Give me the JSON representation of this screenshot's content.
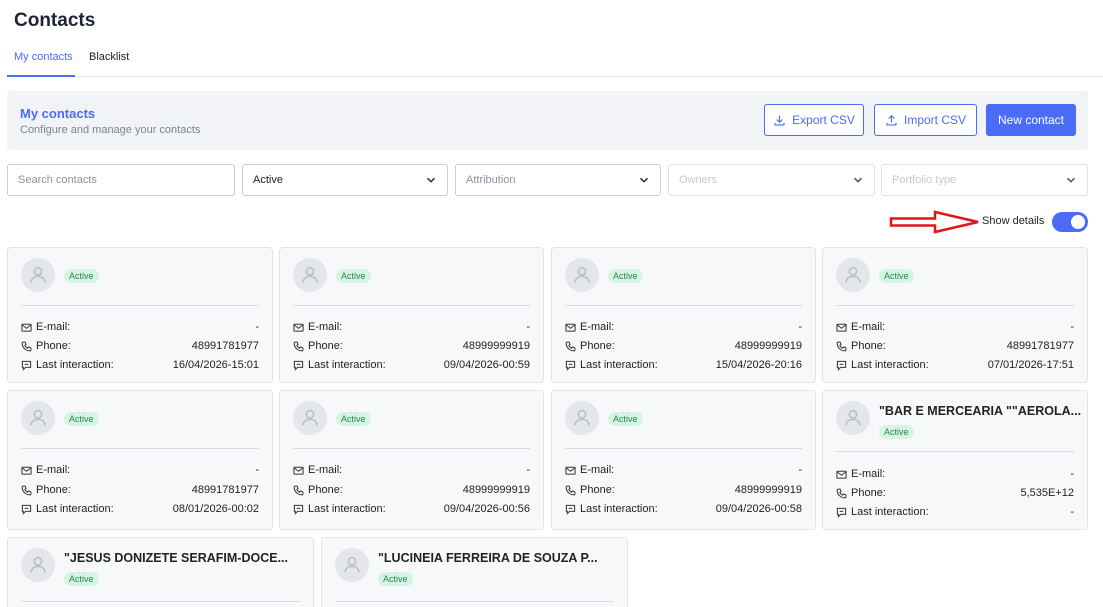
{
  "page": {
    "title": "Contacts"
  },
  "tabs": [
    {
      "label": "My contacts",
      "active": true
    },
    {
      "label": "Blacklist",
      "active": false
    }
  ],
  "header": {
    "title": "My contacts",
    "subtitle": "Configure and manage your contacts",
    "export_label": "Export CSV",
    "import_label": "Import CSV",
    "new_label": "New contact"
  },
  "filters": {
    "search_placeholder": "Search contacts",
    "status_value": "Active",
    "attribution_placeholder": "Attribution",
    "owners_placeholder": "Owners",
    "portfolio_placeholder": "Portfolio type"
  },
  "details_toggle": {
    "label": "Show details",
    "on": true
  },
  "labels": {
    "email": "E-mail:",
    "phone": "Phone:",
    "last_interaction": "Last interaction:"
  },
  "colors": {
    "accent": "#4a6cf7",
    "badge_bg": "#d6f3e3",
    "badge_text": "#1f8b4c",
    "annotation_arrow": "#e0161b"
  },
  "cards": [
    {
      "name": "",
      "status": "Active",
      "email": "-",
      "phone": "48991781977",
      "last_interaction": "16/04/2026-15:01"
    },
    {
      "name": "",
      "status": "Active",
      "email": "-",
      "phone": "48999999919",
      "last_interaction": "09/04/2026-00:59"
    },
    {
      "name": "",
      "status": "Active",
      "email": "-",
      "phone": "48999999919",
      "last_interaction": "15/04/2026-20:16"
    },
    {
      "name": "",
      "status": "Active",
      "email": "-",
      "phone": "48991781977",
      "last_interaction": "07/01/2026-17:51"
    },
    {
      "name": "",
      "status": "Active",
      "email": "-",
      "phone": "48991781977",
      "last_interaction": "08/01/2026-00:02"
    },
    {
      "name": "",
      "status": "Active",
      "email": "-",
      "phone": "48999999919",
      "last_interaction": "09/04/2026-00:56"
    },
    {
      "name": "",
      "status": "Active",
      "email": "-",
      "phone": "48999999919",
      "last_interaction": "09/04/2026-00:58"
    },
    {
      "name": "\"BAR E MERCEARIA \"\"AEROLA...",
      "status": "Active",
      "email": "-",
      "phone": "5,535E+12",
      "last_interaction": "-"
    },
    {
      "name": "\"JESUS DONIZETE SERAFIM-DOCE...",
      "status": "Active"
    },
    {
      "name": "\"LUCINEIA FERREIRA DE SOUZA P...",
      "status": "Active"
    }
  ]
}
